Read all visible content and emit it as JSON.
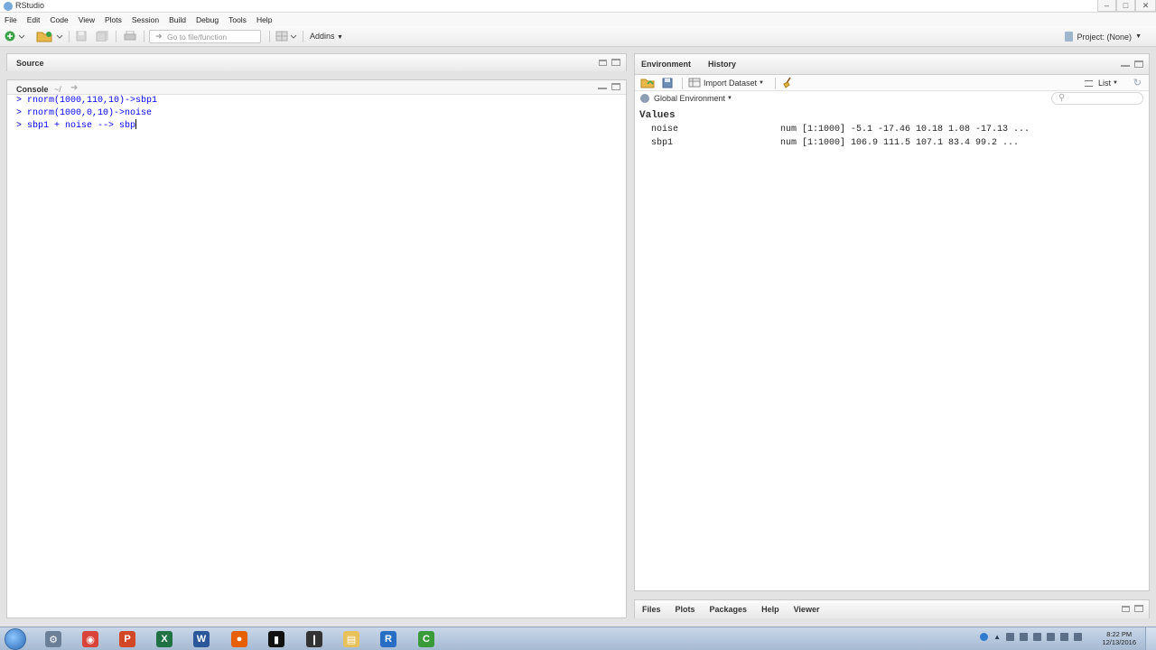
{
  "window": {
    "title": "RStudio"
  },
  "menu": [
    "File",
    "Edit",
    "Code",
    "View",
    "Plots",
    "Session",
    "Build",
    "Debug",
    "Tools",
    "Help"
  ],
  "toolbar": {
    "goto_placeholder": "Go to file/function",
    "addins_label": "Addins",
    "project_label": "Project: (None)"
  },
  "source_pane": {
    "title": "Source"
  },
  "console_pane": {
    "title": "Console",
    "path": "~/",
    "lines": [
      {
        "prompt": ">",
        "code": "rnorm(1000,110,10)->sbp1"
      },
      {
        "prompt": ">",
        "code": "rnorm(1000,0,10)->noise"
      },
      {
        "prompt": ">",
        "code": "sbp1 + noise --> sbp"
      }
    ]
  },
  "environment_pane": {
    "tabs": [
      "Environment",
      "History"
    ],
    "import_label": "Import Dataset",
    "list_label": "List",
    "scope_label": "Global Environment",
    "section_header": "Values",
    "rows": [
      {
        "name": "noise",
        "value": "num [1:1000] -5.1 -17.46 10.18 1.08 -17.13 ..."
      },
      {
        "name": "sbp1",
        "value": "num [1:1000] 106.9 111.5 107.1 83.4 99.2 ..."
      }
    ]
  },
  "files_pane": {
    "tabs": [
      "Files",
      "Plots",
      "Packages",
      "Help",
      "Viewer"
    ]
  },
  "taskbar": {
    "apps": [
      {
        "name": "windows-explorer-icon",
        "color": "#6b7f96",
        "glyph": "⚙"
      },
      {
        "name": "chrome-icon",
        "color": "#d9443a",
        "glyph": "◉"
      },
      {
        "name": "powerpoint-icon",
        "color": "#d24726",
        "glyph": "P"
      },
      {
        "name": "excel-icon",
        "color": "#1f7244",
        "glyph": "X"
      },
      {
        "name": "word-icon",
        "color": "#2b579a",
        "glyph": "W"
      },
      {
        "name": "firefox-icon",
        "color": "#e66000",
        "glyph": "●"
      },
      {
        "name": "terminal-icon",
        "color": "#111111",
        "glyph": "▮"
      },
      {
        "name": "audio-icon",
        "color": "#333333",
        "glyph": "❙"
      },
      {
        "name": "folder-icon",
        "color": "#e8c15a",
        "glyph": "▤"
      },
      {
        "name": "r-icon",
        "color": "#276dc3",
        "glyph": "R"
      },
      {
        "name": "camtasia-icon",
        "color": "#3a9b3a",
        "glyph": "C"
      }
    ],
    "clock_time": "8:22 PM",
    "clock_date": "12/13/2016"
  }
}
